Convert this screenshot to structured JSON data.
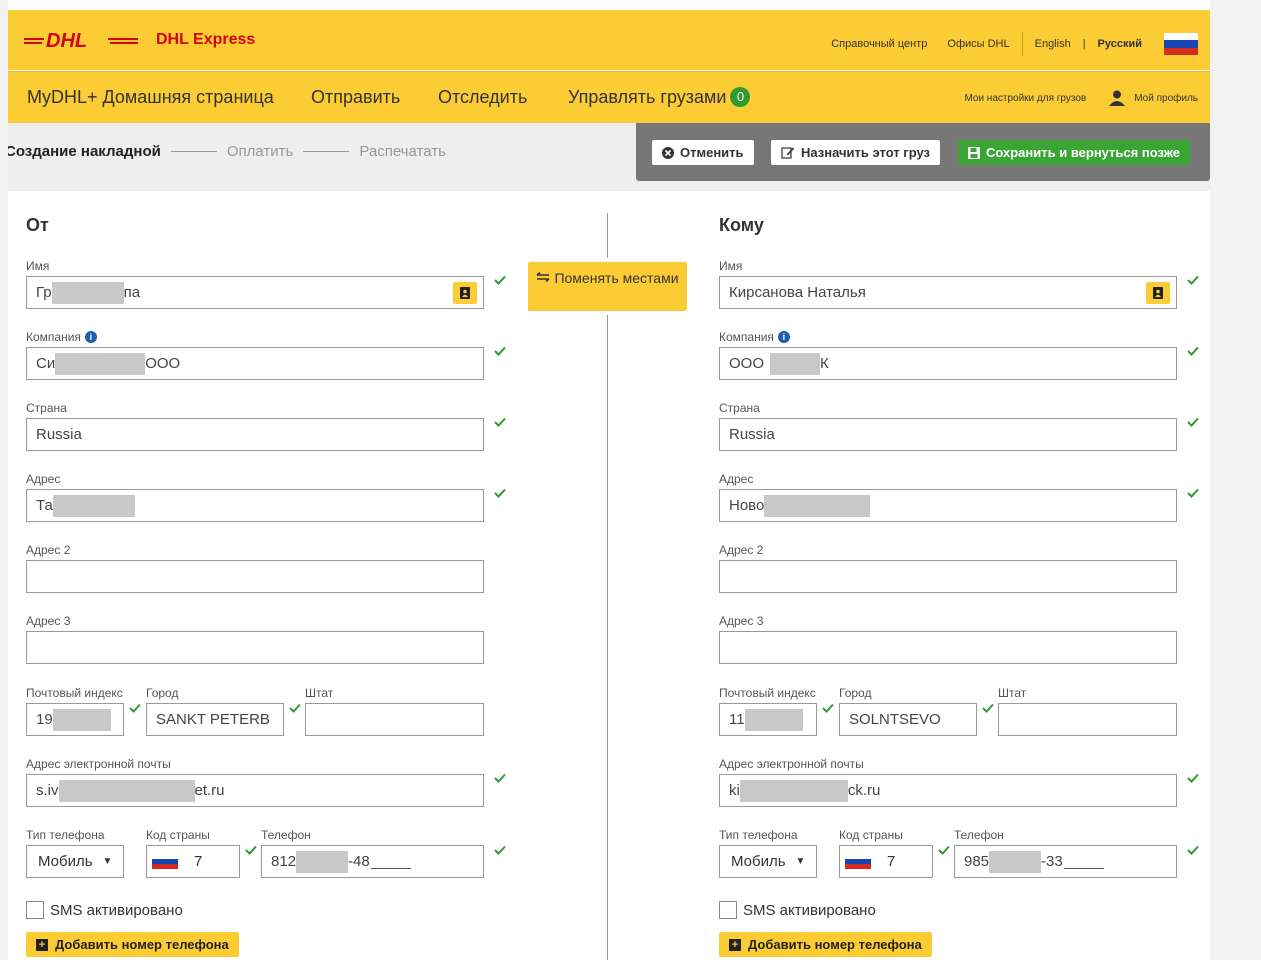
{
  "header": {
    "brand_logo": "DHL",
    "brand": "DHL Express",
    "links": [
      "Справочный центр",
      "Офисы DHL",
      "English",
      "|",
      "Русский"
    ],
    "language_flag": "russia-flag-icon"
  },
  "nav": {
    "home": "MyDHL+ Домашняя страница",
    "send": "Отправить",
    "track": "Отследить",
    "manage": "Управлять грузами",
    "manage_count": "0",
    "settings": "Мои настройки для грузов",
    "profile": "Мой профиль"
  },
  "steps": {
    "current": "Создание накладной",
    "pay": "Оплатить",
    "print": "Распечатать"
  },
  "actions": {
    "cancel": "Отменить",
    "assign": "Назначить этот груз",
    "save_later": "Сохранить и вернуться позже"
  },
  "swap_label": "Поменять местами",
  "colors": {
    "brand_yellow": "#fccc34",
    "dhl_red": "#d40511",
    "success_green": "#3aa534",
    "check_green": "#2f9a2f"
  },
  "labels": {
    "name": "Имя",
    "company": "Компания",
    "country": "Страна",
    "address": "Адрес",
    "address2": "Адрес 2",
    "address3": "Адрес 3",
    "postal": "Почтовый индекс",
    "city": "Город",
    "state": "Штат",
    "email": "Адрес электронной почты",
    "phone_type": "Тип телефона",
    "country_code": "Код страны",
    "phone": "Телефон",
    "sms": "SMS активировано",
    "add_phone": "Добавить номер телефона"
  },
  "from": {
    "title": "От",
    "name_a": "Гр",
    "name_b": "па",
    "company_a": "Си",
    "company_b": " ООО",
    "country": "Russia",
    "address_a": "Та",
    "postal_a": "19",
    "city": "SANKT PETERB",
    "state": "",
    "email_a": "s.iv",
    "email_b": "et.ru",
    "phone_type": "Мобиль",
    "country_code": "7",
    "phone_a": "812",
    "phone_b": "-48"
  },
  "to": {
    "title": "Кому",
    "name": "Кирсанова Наталья",
    "company_a": "ООО",
    "company_b": "К",
    "country": "Russia",
    "address_a": "Ново",
    "postal_a": "11",
    "city": "SOLNTSEVO",
    "state": "",
    "email_a": "ki",
    "email_b": "ck.ru",
    "phone_type": "Мобиль",
    "country_code": "7",
    "phone_a": "985",
    "phone_b": "-33"
  }
}
